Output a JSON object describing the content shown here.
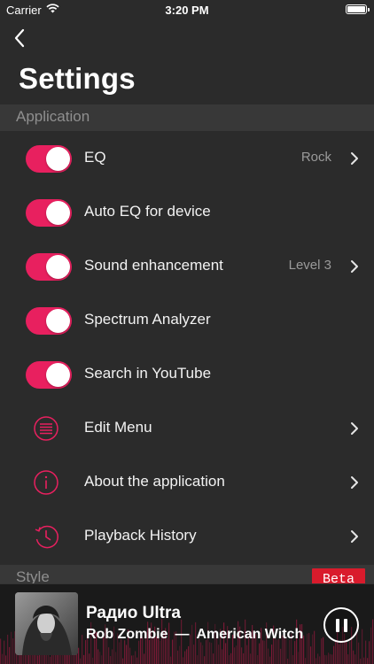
{
  "status_bar": {
    "carrier": "Carrier",
    "time": "3:20 PM"
  },
  "header": {
    "title": "Settings",
    "back_icon": "chevron-left-icon"
  },
  "sections": {
    "application": {
      "label": "Application"
    },
    "style": {
      "label": "Style",
      "badge": "Beta"
    }
  },
  "settings": [
    {
      "label": "EQ",
      "type": "toggle",
      "on": true,
      "value": "Rock",
      "chevron": true
    },
    {
      "label": "Auto EQ for device",
      "type": "toggle",
      "on": true,
      "value": "",
      "chevron": false
    },
    {
      "label": "Sound enhancement",
      "type": "toggle",
      "on": true,
      "value": "Level 3",
      "chevron": true
    },
    {
      "label": "Spectrum Analyzer",
      "type": "toggle",
      "on": true,
      "value": "",
      "chevron": false
    },
    {
      "label": "Search in YouTube",
      "type": "toggle",
      "on": true,
      "value": "",
      "chevron": false
    },
    {
      "label": "Edit Menu",
      "type": "icon",
      "icon": "list-menu-icon",
      "chevron": true
    },
    {
      "label": "About the application",
      "type": "icon",
      "icon": "info-icon",
      "chevron": true
    },
    {
      "label": "Playback History",
      "type": "icon",
      "icon": "history-clock-icon",
      "chevron": true
    }
  ],
  "player": {
    "station": "Радио Ultra",
    "artist": "Rob Zombie",
    "separator": "—",
    "track": "American Witch",
    "state": "playing",
    "control_icon": "pause-icon"
  },
  "colors": {
    "accent": "#e8205f",
    "background": "#2b2b2b",
    "section_header": "#383838",
    "badge": "#d91b2c",
    "muted_text": "#9a9a9a"
  }
}
